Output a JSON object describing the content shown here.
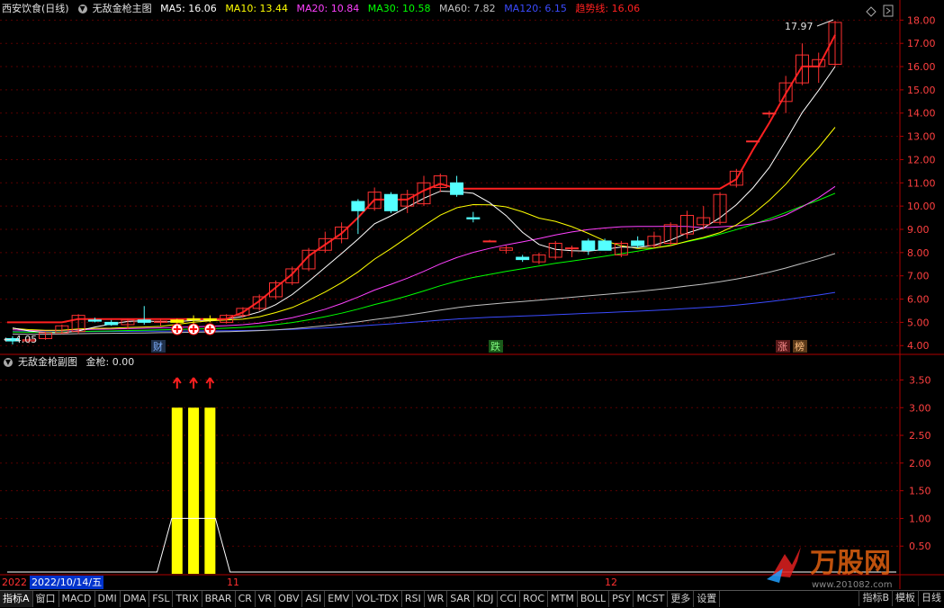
{
  "main_header": {
    "stock_name": "西安饮食(日线)",
    "indicator_name": "无敌金枪主图",
    "ma": [
      {
        "label": "MA5: 16.06",
        "color": "#ffffff"
      },
      {
        "label": "MA10: 13.44",
        "color": "#ffff00"
      },
      {
        "label": "MA20: 10.84",
        "color": "#ff40ff"
      },
      {
        "label": "MA30: 10.58",
        "color": "#00ff00"
      },
      {
        "label": "MA60: 7.82",
        "color": "#c0c0c0"
      },
      {
        "label": "MA120: 6.15",
        "color": "#3b4bff"
      }
    ],
    "trend_label": "趋势线: 16.06",
    "trend_color": "#ff2020"
  },
  "sub_header": {
    "indicator_name": "无敌金枪副图",
    "value_label": "金枪: 0.00"
  },
  "main_axis": [
    "18.00",
    "17.00",
    "16.00",
    "15.00",
    "14.00",
    "13.00",
    "12.00",
    "11.00",
    "10.00",
    "9.00",
    "8.00",
    "7.00",
    "6.00",
    "5.00",
    "4.00"
  ],
  "sub_axis": [
    "3.50",
    "3.00",
    "2.50",
    "2.00",
    "1.50",
    "1.00",
    "0.50"
  ],
  "annotations": {
    "high_price": "17.97",
    "low_price": "4.05",
    "low_arrow": "←",
    "tag_cai": "财",
    "tag_die": "跌",
    "tag_zhang": "涨",
    "tag_bang": "榜"
  },
  "dates": {
    "year": "2022",
    "cursor_date": "2022/10/14/五",
    "month_11": "11",
    "month_12": "12"
  },
  "tabs": [
    "指标A",
    "窗口",
    "MACD",
    "DMI",
    "DMA",
    "FSL",
    "TRIX",
    "BRAR",
    "CR",
    "VR",
    "OBV",
    "ASI",
    "EMV",
    "VOL-TDX",
    "RSI",
    "WR",
    "SAR",
    "KDJ",
    "CCI",
    "ROC",
    "MTM",
    "BOLL",
    "PSY",
    "MCST",
    "更多",
    "设置"
  ],
  "right_tabs": [
    "指标B",
    "模板",
    "日线"
  ],
  "watermark": {
    "text": "万股网",
    "sub": "www.201082.com"
  },
  "colors": {
    "grid": "#5a0000",
    "axis": "#b00000",
    "up": "#ff3030",
    "down": "#54ffff",
    "signal": "#ffff00"
  },
  "chart_data": {
    "type": "candlestick",
    "y_range": [
      3.7,
      18.4
    ],
    "candles": [
      {
        "o": 4.3,
        "h": 4.4,
        "l": 4.05,
        "c": 4.2
      },
      {
        "o": 4.2,
        "h": 4.35,
        "l": 4.1,
        "c": 4.25
      },
      {
        "o": 4.3,
        "h": 4.6,
        "l": 4.25,
        "c": 4.55
      },
      {
        "o": 4.55,
        "h": 4.9,
        "l": 4.5,
        "c": 4.85
      },
      {
        "o": 4.6,
        "h": 5.35,
        "l": 4.5,
        "c": 5.3
      },
      {
        "o": 5.1,
        "h": 5.2,
        "l": 5.0,
        "c": 5.05
      },
      {
        "o": 5.0,
        "h": 5.1,
        "l": 4.85,
        "c": 4.9
      },
      {
        "o": 4.9,
        "h": 5.15,
        "l": 4.7,
        "c": 5.1
      },
      {
        "o": 5.1,
        "h": 5.7,
        "l": 4.9,
        "c": 5.0
      },
      {
        "o": 5.0,
        "h": 5.15,
        "l": 4.85,
        "c": 5.05
      },
      {
        "o": 5.0,
        "h": 5.15,
        "l": 4.9,
        "c": 5.1
      },
      {
        "o": 5.1,
        "h": 5.3,
        "l": 4.9,
        "c": 5.15
      },
      {
        "o": 5.15,
        "h": 5.3,
        "l": 5.0,
        "c": 5.1
      },
      {
        "o": 5.0,
        "h": 5.35,
        "l": 4.95,
        "c": 5.3
      },
      {
        "o": 5.3,
        "h": 5.65,
        "l": 5.2,
        "c": 5.6
      },
      {
        "o": 5.6,
        "h": 6.2,
        "l": 5.5,
        "c": 6.1
      },
      {
        "o": 6.1,
        "h": 6.8,
        "l": 6.0,
        "c": 6.7
      },
      {
        "o": 6.7,
        "h": 7.4,
        "l": 6.6,
        "c": 7.3
      },
      {
        "o": 7.3,
        "h": 8.2,
        "l": 7.2,
        "c": 8.1
      },
      {
        "o": 8.1,
        "h": 8.9,
        "l": 8.0,
        "c": 8.6
      },
      {
        "o": 8.6,
        "h": 9.3,
        "l": 8.4,
        "c": 9.1
      },
      {
        "o": 10.2,
        "h": 10.3,
        "l": 8.8,
        "c": 9.8
      },
      {
        "o": 9.9,
        "h": 10.8,
        "l": 9.8,
        "c": 10.6
      },
      {
        "o": 10.5,
        "h": 10.6,
        "l": 9.7,
        "c": 9.8
      },
      {
        "o": 10.0,
        "h": 10.7,
        "l": 9.7,
        "c": 10.5
      },
      {
        "o": 10.1,
        "h": 11.3,
        "l": 10.0,
        "c": 11.0
      },
      {
        "o": 10.8,
        "h": 11.4,
        "l": 10.6,
        "c": 11.3
      },
      {
        "o": 11.0,
        "h": 11.3,
        "l": 10.4,
        "c": 10.5
      },
      {
        "o": 9.5,
        "h": 9.75,
        "l": 9.3,
        "c": 9.45
      },
      {
        "o": 8.5,
        "h": 8.55,
        "l": 8.45,
        "c": 8.5
      },
      {
        "o": 8.1,
        "h": 8.3,
        "l": 7.95,
        "c": 8.2
      },
      {
        "o": 7.8,
        "h": 7.9,
        "l": 7.6,
        "c": 7.7
      },
      {
        "o": 7.6,
        "h": 8.0,
        "l": 7.5,
        "c": 7.9
      },
      {
        "o": 7.8,
        "h": 8.5,
        "l": 7.7,
        "c": 8.4
      },
      {
        "o": 8.2,
        "h": 8.3,
        "l": 7.8,
        "c": 8.2
      },
      {
        "o": 8.5,
        "h": 8.6,
        "l": 7.9,
        "c": 8.1
      },
      {
        "o": 8.5,
        "h": 8.6,
        "l": 8.3,
        "c": 8.1
      },
      {
        "o": 7.9,
        "h": 8.5,
        "l": 7.8,
        "c": 8.4
      },
      {
        "o": 8.5,
        "h": 8.7,
        "l": 8.2,
        "c": 8.3
      },
      {
        "o": 8.3,
        "h": 8.9,
        "l": 8.2,
        "c": 8.7
      },
      {
        "o": 8.4,
        "h": 9.3,
        "l": 8.3,
        "c": 9.2
      },
      {
        "o": 8.8,
        "h": 9.8,
        "l": 8.6,
        "c": 9.6
      },
      {
        "o": 9.2,
        "h": 10.0,
        "l": 9.0,
        "c": 9.5
      },
      {
        "o": 9.3,
        "h": 10.6,
        "l": 9.2,
        "c": 10.5
      },
      {
        "o": 10.9,
        "h": 11.6,
        "l": 10.8,
        "c": 11.5
      },
      {
        "o": 12.8,
        "h": 12.8,
        "l": 12.8,
        "c": 12.8
      },
      {
        "o": 14.0,
        "h": 14.1,
        "l": 13.8,
        "c": 14.0
      },
      {
        "o": 14.5,
        "h": 15.6,
        "l": 14.0,
        "c": 15.3
      },
      {
        "o": 15.3,
        "h": 17.0,
        "l": 15.2,
        "c": 16.5
      },
      {
        "o": 16.0,
        "h": 16.6,
        "l": 15.3,
        "c": 16.3
      },
      {
        "o": 16.1,
        "h": 17.97,
        "l": 16.0,
        "c": 17.9
      }
    ],
    "sub_signals": [
      0,
      0,
      0,
      0,
      0,
      0,
      0,
      0,
      0,
      0,
      0,
      3,
      3,
      3,
      0
    ]
  }
}
